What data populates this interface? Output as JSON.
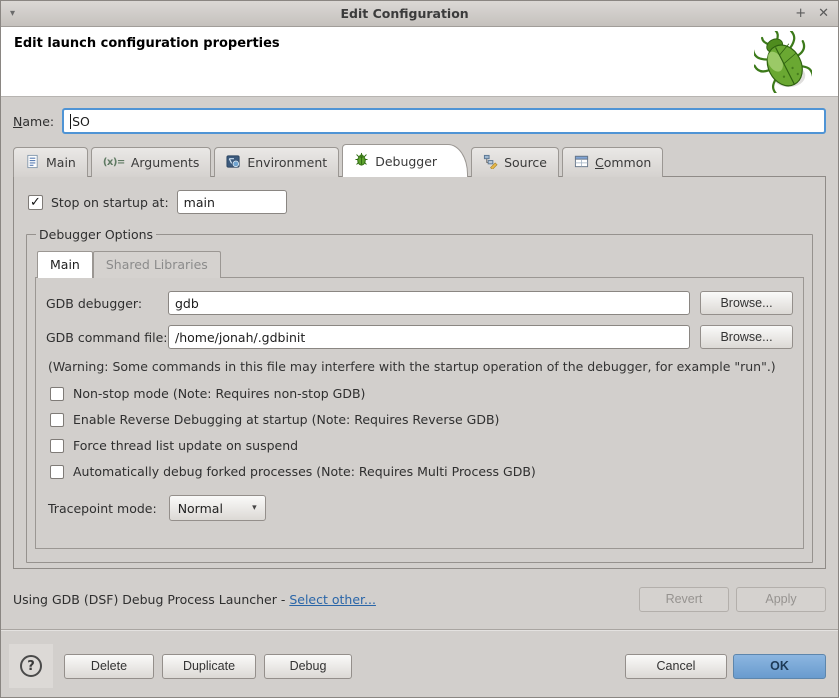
{
  "window": {
    "title": "Edit Configuration",
    "shade_glyph": "▾",
    "maximize_glyph": "+",
    "close_glyph": "✕"
  },
  "header": {
    "title": "Edit launch configuration properties"
  },
  "name_row": {
    "label": "Name:",
    "value": "SO"
  },
  "tabs": [
    {
      "label": "Main",
      "icon": "document-icon",
      "active": false
    },
    {
      "label": "Arguments",
      "icon": "arguments-icon",
      "glyph": "(x)=",
      "active": false
    },
    {
      "label": "Environment",
      "icon": "environment-icon",
      "active": false
    },
    {
      "label": "Debugger",
      "icon": "debugger-bug-icon",
      "active": true
    },
    {
      "label": "Source",
      "icon": "source-icon",
      "active": false
    },
    {
      "label": "Common",
      "icon": "common-icon",
      "active": false
    }
  ],
  "debugger_tab": {
    "stop_label": "Stop on startup at:",
    "stop_checked": true,
    "stop_value": "main",
    "group_title": "Debugger Options",
    "sub_tabs": [
      {
        "label": "Main",
        "active": true
      },
      {
        "label": "Shared Libraries",
        "active": false
      }
    ],
    "fields": [
      {
        "label": "GDB debugger:",
        "value": "gdb",
        "button": "Browse..."
      },
      {
        "label": "GDB command file:",
        "value": "/home/jonah/.gdbinit",
        "button": "Browse..."
      }
    ],
    "warning": "(Warning: Some commands in this file may interfere with the startup operation of the debugger, for example \"run\".)",
    "checkboxes": [
      {
        "label": "Non-stop mode (Note: Requires non-stop GDB)",
        "checked": false
      },
      {
        "label": "Enable Reverse Debugging at startup (Note: Requires Reverse GDB)",
        "checked": false
      },
      {
        "label": "Force thread list update on suspend",
        "checked": false
      },
      {
        "label": "Automatically debug forked processes (Note: Requires Multi Process GDB)",
        "checked": false
      }
    ],
    "tracepoint_label": "Tracepoint mode:",
    "tracepoint_value": "Normal"
  },
  "launcher": {
    "text": "Using GDB (DSF) Debug Process Launcher - ",
    "link": "Select other...",
    "revert": "Revert",
    "apply": "Apply"
  },
  "footer": {
    "help": "?",
    "delete": "Delete",
    "duplicate": "Duplicate",
    "debug": "Debug",
    "cancel": "Cancel",
    "ok": "OK"
  },
  "glyphs": {
    "check": "✓",
    "dropdown_arrow": "▾"
  },
  "colors": {
    "dialog_bg": "#d2cfcc",
    "focus_blue": "#4f94d5",
    "ok_button_blue": "#699bce",
    "link_blue": "#2a66a8",
    "bug_green": "#55951f"
  }
}
